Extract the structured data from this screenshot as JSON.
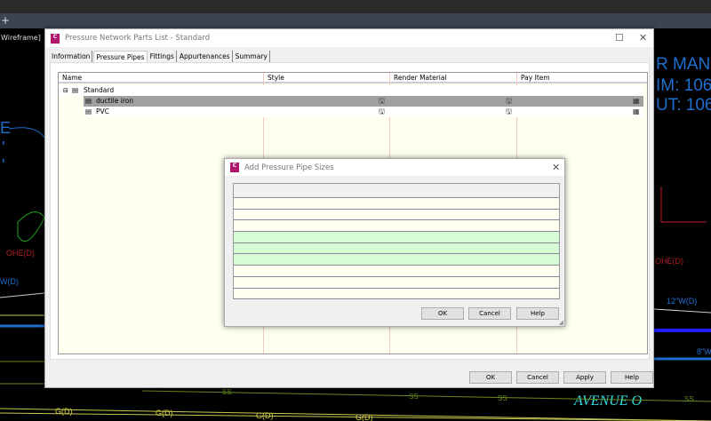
{
  "app": {
    "tab_plus": "+",
    "viewport_label": "Wireframe]"
  },
  "cad": {
    "texts": [
      "R MANH",
      "IM: 106",
      "UT: 106",
      "E",
      "'",
      "'",
      "OHE(D)",
      "OHE(D)",
      "12\"W(D)",
      "W(D)",
      "8\"W",
      "SS",
      "G(D)",
      "AVENUE O"
    ]
  },
  "main_dialog": {
    "title": "Pressure Network Parts List - Standard",
    "tabs": [
      "Information",
      "Pressure Pipes",
      "Fittings",
      "Appurtenances",
      "Summary"
    ],
    "active_tab": "Pressure Pipes",
    "columns": [
      "Name",
      "Style",
      "Render Material",
      "Pay Item"
    ],
    "tree": {
      "root": "Standard",
      "children": [
        {
          "name": "ductile iron",
          "selected": true
        },
        {
          "name": "PVC",
          "selected": false
        }
      ]
    },
    "buttons": {
      "ok": "OK",
      "cancel": "Cancel",
      "apply": "Apply",
      "help": "Help"
    }
  },
  "sub_dialog": {
    "title": "Add Pressure Pipe Sizes",
    "row_count": 9,
    "highlighted_rows": [
      4,
      5,
      6
    ],
    "colors": {
      "row": "#fffff0",
      "highlight": "#d6fcd6"
    },
    "buttons": {
      "ok": "OK",
      "cancel": "Cancel",
      "help": "Help"
    }
  },
  "colors": {
    "accent": "#b0186e",
    "selection": "#a0a0a0"
  }
}
